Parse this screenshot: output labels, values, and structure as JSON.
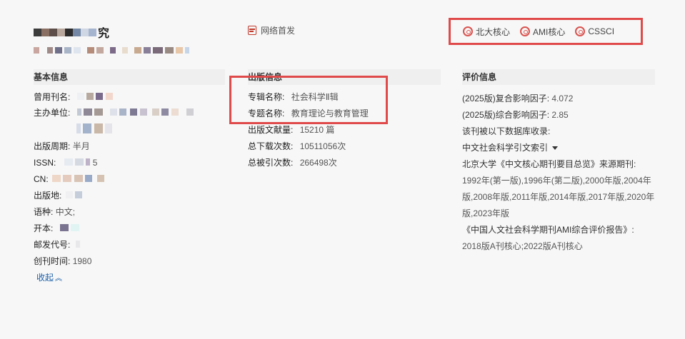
{
  "header": {
    "title_suffix": "究",
    "online_label": "网络首发",
    "badges": [
      "北大核心",
      "AMI核心",
      "CSSCI"
    ]
  },
  "basic": {
    "heading": "基本信息",
    "former_name_label": "曾用刊名:",
    "sponsor_label": "主办单位:",
    "cycle_label": "出版周期:",
    "cycle_value": "半月",
    "issn_label": "ISSN:",
    "issn_tail": "5",
    "cn_label": "CN:",
    "place_label": "出版地:",
    "language_label": "语种:",
    "language_value": "中文;",
    "format_label": "开本:",
    "postal_label": "邮发代号:",
    "founded_label": "创刊时间:",
    "founded_value": "1980",
    "collapse_label": "收起"
  },
  "publication": {
    "heading": "出版信息",
    "album_label": "专辑名称:",
    "album_value": "社会科学Ⅱ辑",
    "topic_label": "专题名称:",
    "topic_value": "教育理论与教育管理",
    "docs_label": "出版文献量:",
    "docs_value": "15210 篇",
    "downloads_label": "总下载次数:",
    "downloads_value": "10511056次",
    "citations_label": "总被引次数:",
    "citations_value": "266498次"
  },
  "evaluation": {
    "heading": "评价信息",
    "composite_if_label": "(2025版)复合影响因子:",
    "composite_if_value": "4.072",
    "integrated_if_label": "(2025版)综合影响因子:",
    "integrated_if_value": "2.85",
    "db_label": "该刊被以下数据库收录:",
    "db_value": "中文社会科学引文索引",
    "pku_label": "北京大学《中文核心期刊要目总览》来源期刊:",
    "pku_line1": "1992年(第一版),1996年(第二版),2000年版,2004年",
    "pku_line2": "版,2008年版,2011年版,2014年版,2017年版,2020年",
    "pku_line3": "版,2023年版",
    "ami_label": "《中国人文社会科学期刊AMI综合评价报告》:",
    "ami_value": "2018版A刊核心;2022版A刊核心"
  },
  "colors": {
    "accent_red": "#e04a4a",
    "link_blue": "#1a5ea8"
  }
}
